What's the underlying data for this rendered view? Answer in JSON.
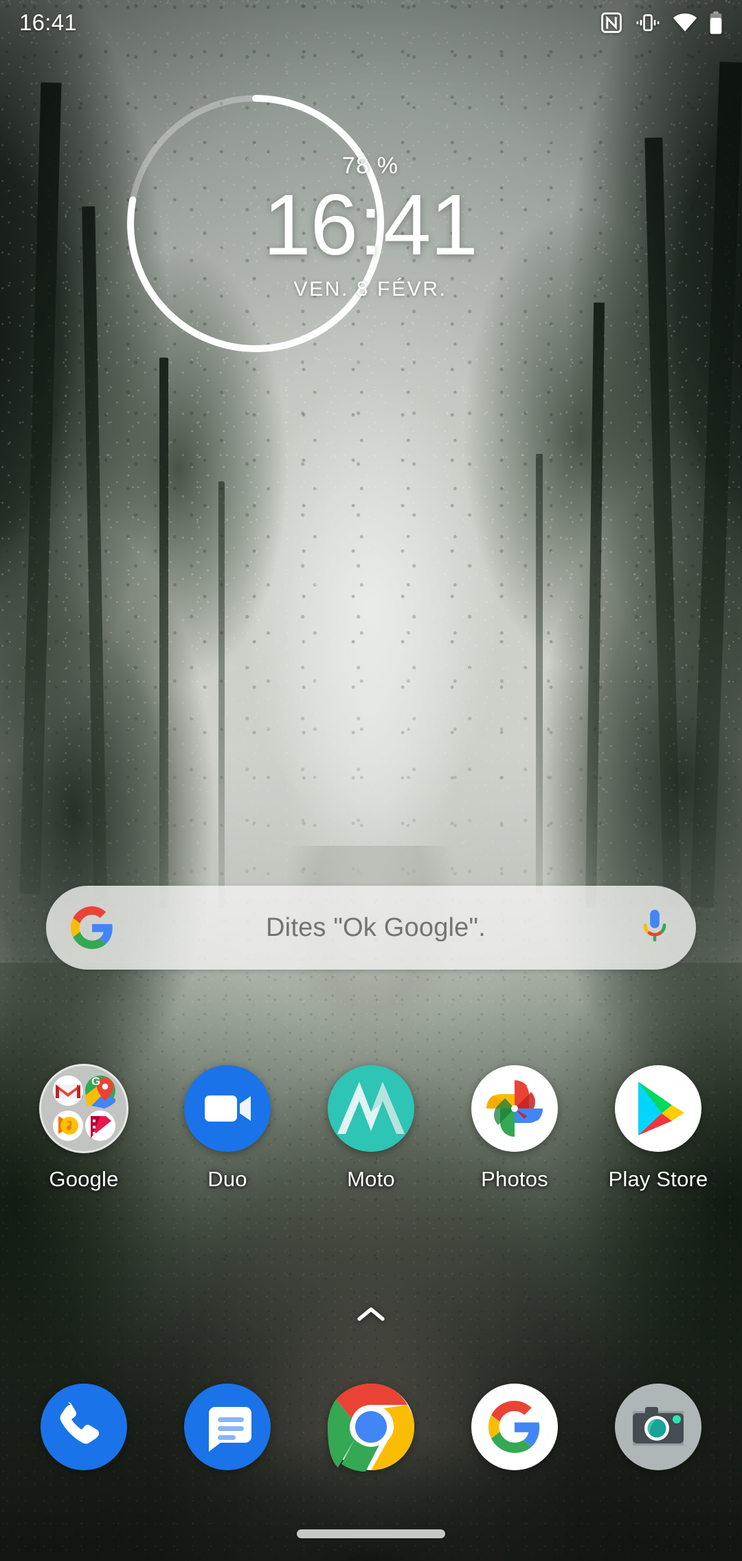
{
  "status_bar": {
    "clock": "16:41",
    "icons": [
      {
        "name": "nfc-icon",
        "label": "NFC"
      },
      {
        "name": "vibrate-icon",
        "label": "Vibrate"
      },
      {
        "name": "wifi-icon",
        "label": "Wi-Fi"
      },
      {
        "name": "battery-icon",
        "label": "Battery"
      }
    ]
  },
  "clock_widget": {
    "battery_percent": "78 %",
    "hours": "16",
    "colon": ":",
    "minutes": "41",
    "date": "VEN. 8 FÉVR.",
    "ring_progress": 78,
    "ring_color": "#ffffff"
  },
  "search": {
    "placeholder": "Dites \"Ok Google\".",
    "google_icon": "google-g-icon",
    "mic_icon": "microphone-icon"
  },
  "apps": [
    {
      "name": "google-folder",
      "label": "Google",
      "icon": "google-folder-icon"
    },
    {
      "name": "duo",
      "label": "Duo",
      "icon": "duo-icon"
    },
    {
      "name": "moto",
      "label": "Moto",
      "icon": "moto-icon"
    },
    {
      "name": "photos",
      "label": "Photos",
      "icon": "google-photos-icon"
    },
    {
      "name": "play-store",
      "label": "Play Store",
      "icon": "play-store-icon"
    }
  ],
  "drawer_handle": {
    "icon": "chevron-up-icon"
  },
  "dock": [
    {
      "name": "phone",
      "label": "Phone",
      "icon": "phone-icon"
    },
    {
      "name": "messages",
      "label": "Messages",
      "icon": "messages-icon"
    },
    {
      "name": "chrome",
      "label": "Chrome",
      "icon": "chrome-icon"
    },
    {
      "name": "google",
      "label": "Google",
      "icon": "google-g-icon"
    },
    {
      "name": "camera",
      "label": "Camera",
      "icon": "camera-icon"
    }
  ],
  "nav_bar": {
    "icon": "gesture-pill"
  },
  "colors": {
    "accent_blue": "#1a73e8",
    "google_blue": "#4285f4",
    "google_red": "#ea4335",
    "google_yellow": "#fbbc05",
    "google_green": "#34a853",
    "moto_teal": "#3ec6ae",
    "search_bg": "#f2f3f0",
    "placeholder_text": "#737373",
    "label_text": "#ffffff"
  }
}
